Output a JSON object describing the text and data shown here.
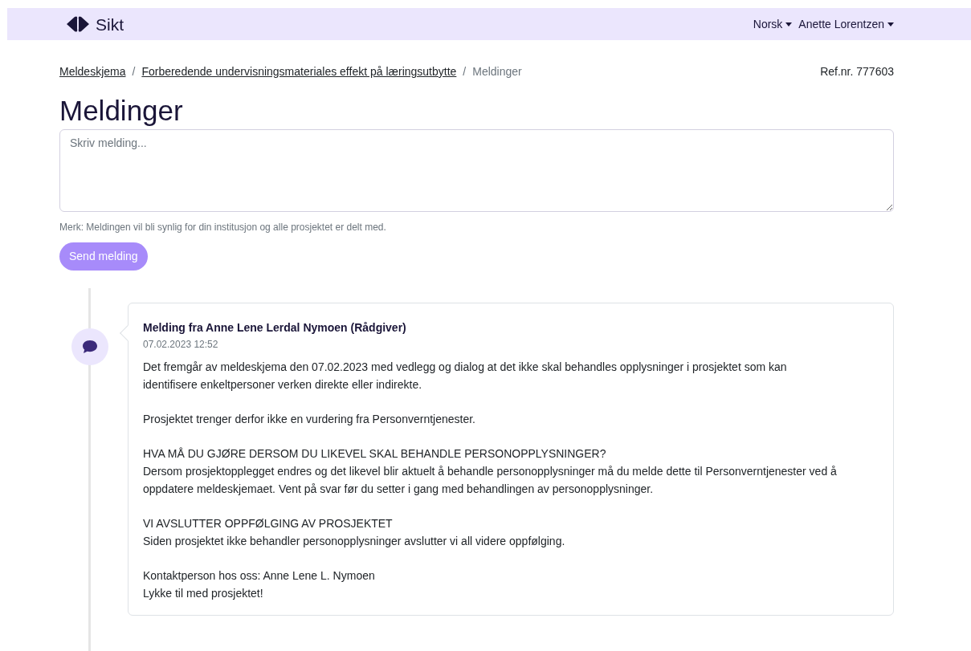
{
  "header": {
    "logo": "Sikt",
    "menus": [
      {
        "label": "Norsk"
      },
      {
        "label": "Anette Lorentzen"
      }
    ]
  },
  "breadcrumb": [
    {
      "label": "Meldeskjema",
      "link": true
    },
    {
      "label": "Forberedende undervisningsmateriales effekt på læringsutbytte",
      "link": true
    },
    {
      "label": "Meldinger",
      "link": false
    }
  ],
  "separator": "/",
  "ref": "Ref.nr. 777603",
  "title": "Meldinger",
  "message_field": {
    "placeholder": "Skriv melding..."
  },
  "note": "Merk: Meldingen vil bli synlig for din institusjon og alle prosjektet er delt med.",
  "send_button": {
    "label": "Send melding",
    "disabled": true
  },
  "messages": [
    {
      "title": "Melding fra Anne Lene Lerdal Nymoen (Rådgiver)",
      "time": "07.02.2023 12:52",
      "paragraphs": [
        [
          "Det fremgår av meldeskjema den 07.02.2023 med vedlegg og dialog at det ikke skal behandles opplysninger i prosjektet som kan identifisere enkeltpersoner verken direkte eller indirekte."
        ],
        [
          "Prosjektet trenger derfor ikke en vurdering fra Personverntjenester."
        ],
        [
          "HVA MÅ DU GJØRE DERSOM DU LIKEVEL SKAL BEHANDLE PERSONOPPLYSNINGER?",
          "Dersom prosjektopplegget endres og det likevel blir aktuelt å behandle personopplysninger må du melde dette til Personverntjenester ved å oppdatere meldeskjemaet. Vent på svar før du setter i gang med behandlingen av personopplysninger."
        ],
        [
          "VI AVSLUTTER OPPFØLGING AV PROSJEKTET",
          "Siden prosjektet ikke behandler personopplysninger avslutter vi all videre oppfølging."
        ],
        [
          "Kontaktperson hos oss: Anne Lene L. Nymoen",
          "Lykke til med prosjektet!"
        ]
      ]
    }
  ]
}
